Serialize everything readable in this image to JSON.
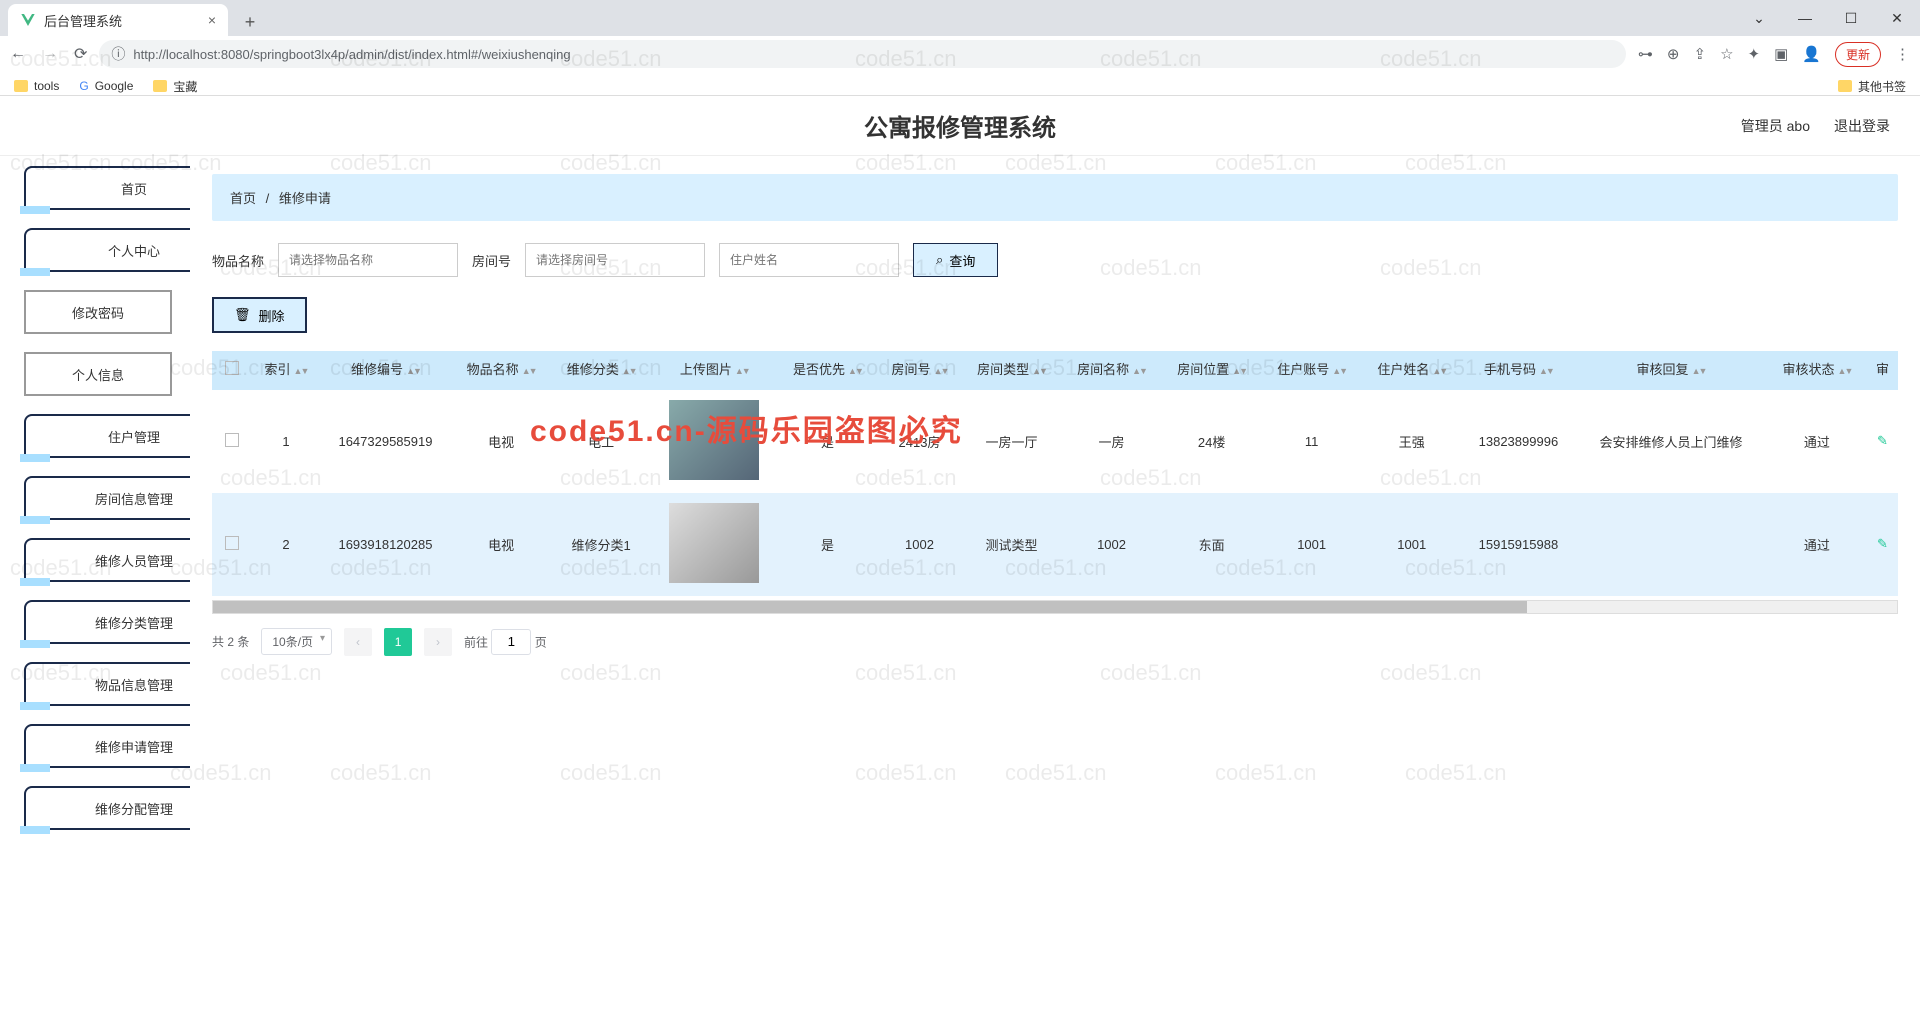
{
  "browser": {
    "tab_title": "后台管理系统",
    "url": "http://localhost:8080/springboot3lx4p/admin/dist/index.html#/weixiushenqing",
    "update": "更新",
    "bookmarks": {
      "tools": "tools",
      "google": "Google",
      "treasure": "宝藏",
      "other": "其他书签"
    }
  },
  "header": {
    "title": "公寓报修管理系统",
    "user": "管理员 abo",
    "logout": "退出登录"
  },
  "sidebar": {
    "home": "首页",
    "personal": "个人中心",
    "change_pwd": "修改密码",
    "personal_info": "个人信息",
    "tenant": "住户管理",
    "room": "房间信息管理",
    "staff": "维修人员管理",
    "category": "维修分类管理",
    "goods": "物品信息管理",
    "repair_apply": "维修申请管理",
    "repair_assign": "维修分配管理"
  },
  "breadcrumb": {
    "home": "首页",
    "sep": "/",
    "current": "维修申请"
  },
  "search": {
    "goods_label": "物品名称",
    "goods_placeholder": "请选择物品名称",
    "room_label": "房间号",
    "room_placeholder": "请选择房间号",
    "tenant_placeholder": "住户姓名",
    "query": "查询",
    "delete": "删除"
  },
  "table": {
    "headers": {
      "index": "索引",
      "repair_no": "维修编号",
      "goods": "物品名称",
      "category": "维修分类",
      "upload": "上传图片",
      "priority": "是否优先",
      "room_no": "房间号",
      "room_type": "房间类型",
      "room_name": "房间名称",
      "room_loc": "房间位置",
      "tenant_acc": "住户账号",
      "tenant_name": "住户姓名",
      "phone": "手机号码",
      "reply": "审核回复",
      "status": "审核状态",
      "review": "审"
    },
    "rows": [
      {
        "index": "1",
        "repair_no": "1647329585919",
        "goods": "电视",
        "category": "电工",
        "priority": "是",
        "room_no": "2413房",
        "room_type": "一房一厅",
        "room_name": "一房",
        "room_loc": "24楼",
        "tenant_acc": "11",
        "tenant_name": "王强",
        "phone": "13823899996",
        "reply": "会安排维修人员上门维修",
        "status": "通过"
      },
      {
        "index": "2",
        "repair_no": "1693918120285",
        "goods": "电视",
        "category": "维修分类1",
        "priority": "是",
        "room_no": "1002",
        "room_type": "测试类型",
        "room_name": "1002",
        "room_loc": "东面",
        "tenant_acc": "1001",
        "tenant_name": "1001",
        "phone": "15915915988",
        "reply": "",
        "status": "通过"
      }
    ]
  },
  "pager": {
    "total": "共 2 条",
    "page_size": "10条/页",
    "current": "1",
    "goto_label": "前往",
    "goto_value": "1",
    "goto_suffix": "页"
  },
  "watermark": "code51.cn",
  "watermark_red": "code51.cn-源码乐园盗图必究"
}
